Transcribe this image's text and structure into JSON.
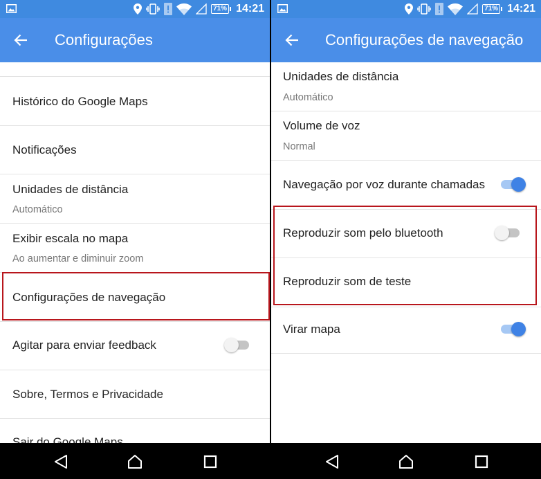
{
  "colors": {
    "status_bar": "#3f8ae0",
    "app_bar": "#4a8ee8",
    "highlight_border": "#b8161c",
    "toggle_on": "#3f82e5",
    "toggle_off": "#c4c4c4"
  },
  "status_bar": {
    "battery_text": "71%",
    "time": "14:21",
    "icons": [
      "gallery-icon",
      "location-icon",
      "vibrate-icon",
      "data-icon",
      "wifi-icon",
      "signal-icon",
      "battery-icon"
    ]
  },
  "left_screen": {
    "title": "Configurações",
    "items": [
      {
        "title": "Histórico do Google Maps"
      },
      {
        "title": "Notificações"
      },
      {
        "title": "Unidades de distância",
        "subtitle": "Automático"
      },
      {
        "title": "Exibir escala no mapa",
        "subtitle": "Ao aumentar e diminuir zoom"
      },
      {
        "title": "Configurações de navegação",
        "highlighted": true
      },
      {
        "title": "Agitar para enviar feedback",
        "toggle": false
      },
      {
        "title": "Sobre, Termos e Privacidade"
      },
      {
        "title": "Sair do Google Maps"
      }
    ]
  },
  "right_screen": {
    "title": "Configurações de navegação",
    "items": [
      {
        "title": "Unidades de distância",
        "subtitle": "Automático"
      },
      {
        "title": "Volume de voz",
        "subtitle": "Normal"
      },
      {
        "title": "Navegação por voz durante chamadas",
        "toggle": true
      },
      {
        "title": "Reproduzir som pelo bluetooth",
        "toggle": false,
        "highlighted": true
      },
      {
        "title": "Reproduzir som de teste",
        "highlighted": true
      },
      {
        "title": "Virar mapa",
        "toggle": true
      }
    ]
  },
  "nav_bar": {
    "buttons": [
      "back-triangle-icon",
      "home-circle-icon",
      "recents-square-icon"
    ]
  }
}
